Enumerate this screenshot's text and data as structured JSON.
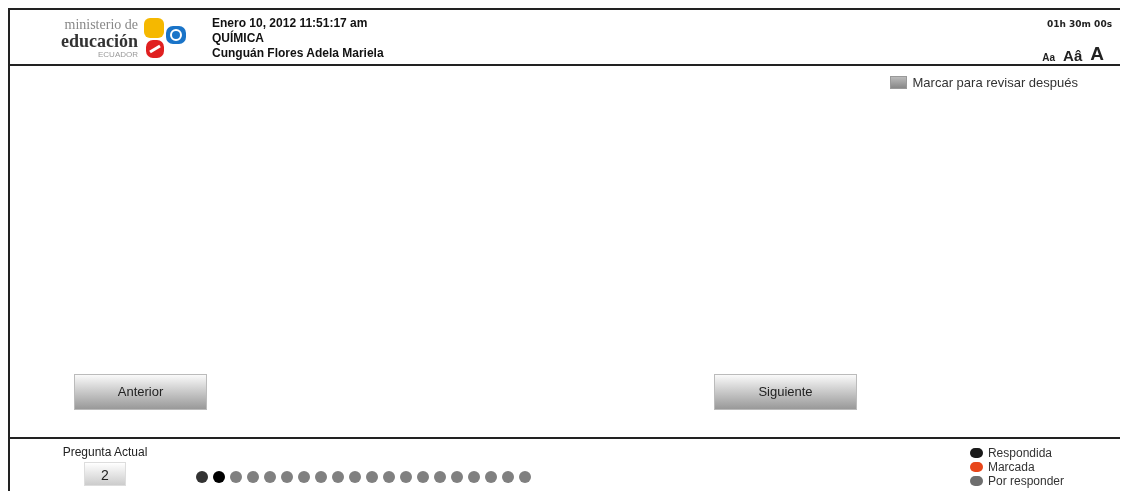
{
  "logo": {
    "line1": "ministerio de",
    "line2": "educación",
    "line3": "ECUADOR"
  },
  "header": {
    "date": "Enero 10, 2012  11:51:17 am",
    "subject": "QUÍMICA",
    "student": "Cunguán Flores Adela Mariela",
    "timer": "01h 30m 00s",
    "font_sizes": [
      "Aa",
      "Aâ",
      "A"
    ]
  },
  "review": {
    "label": "Marcar para revisar después",
    "checked": false
  },
  "buttons": {
    "previous": "Anterior",
    "next": "Siguiente"
  },
  "footer": {
    "current_label": "Pregunta Actual",
    "current_value": "2",
    "questions": [
      {
        "color": "#333333"
      },
      {
        "color": "#000000"
      },
      {
        "color": "#808080"
      },
      {
        "color": "#808080"
      },
      {
        "color": "#808080"
      },
      {
        "color": "#808080"
      },
      {
        "color": "#808080"
      },
      {
        "color": "#808080"
      },
      {
        "color": "#808080"
      },
      {
        "color": "#808080"
      },
      {
        "color": "#808080"
      },
      {
        "color": "#808080"
      },
      {
        "color": "#808080"
      },
      {
        "color": "#808080"
      },
      {
        "color": "#808080"
      },
      {
        "color": "#808080"
      },
      {
        "color": "#808080"
      },
      {
        "color": "#808080"
      },
      {
        "color": "#808080"
      },
      {
        "color": "#808080"
      }
    ],
    "legend": [
      {
        "label": "Respondida",
        "color": "#1a1a1a"
      },
      {
        "label": "Marcada",
        "color": "#e8461a"
      },
      {
        "label": "Por responder",
        "color": "#6e6e6e"
      }
    ]
  }
}
